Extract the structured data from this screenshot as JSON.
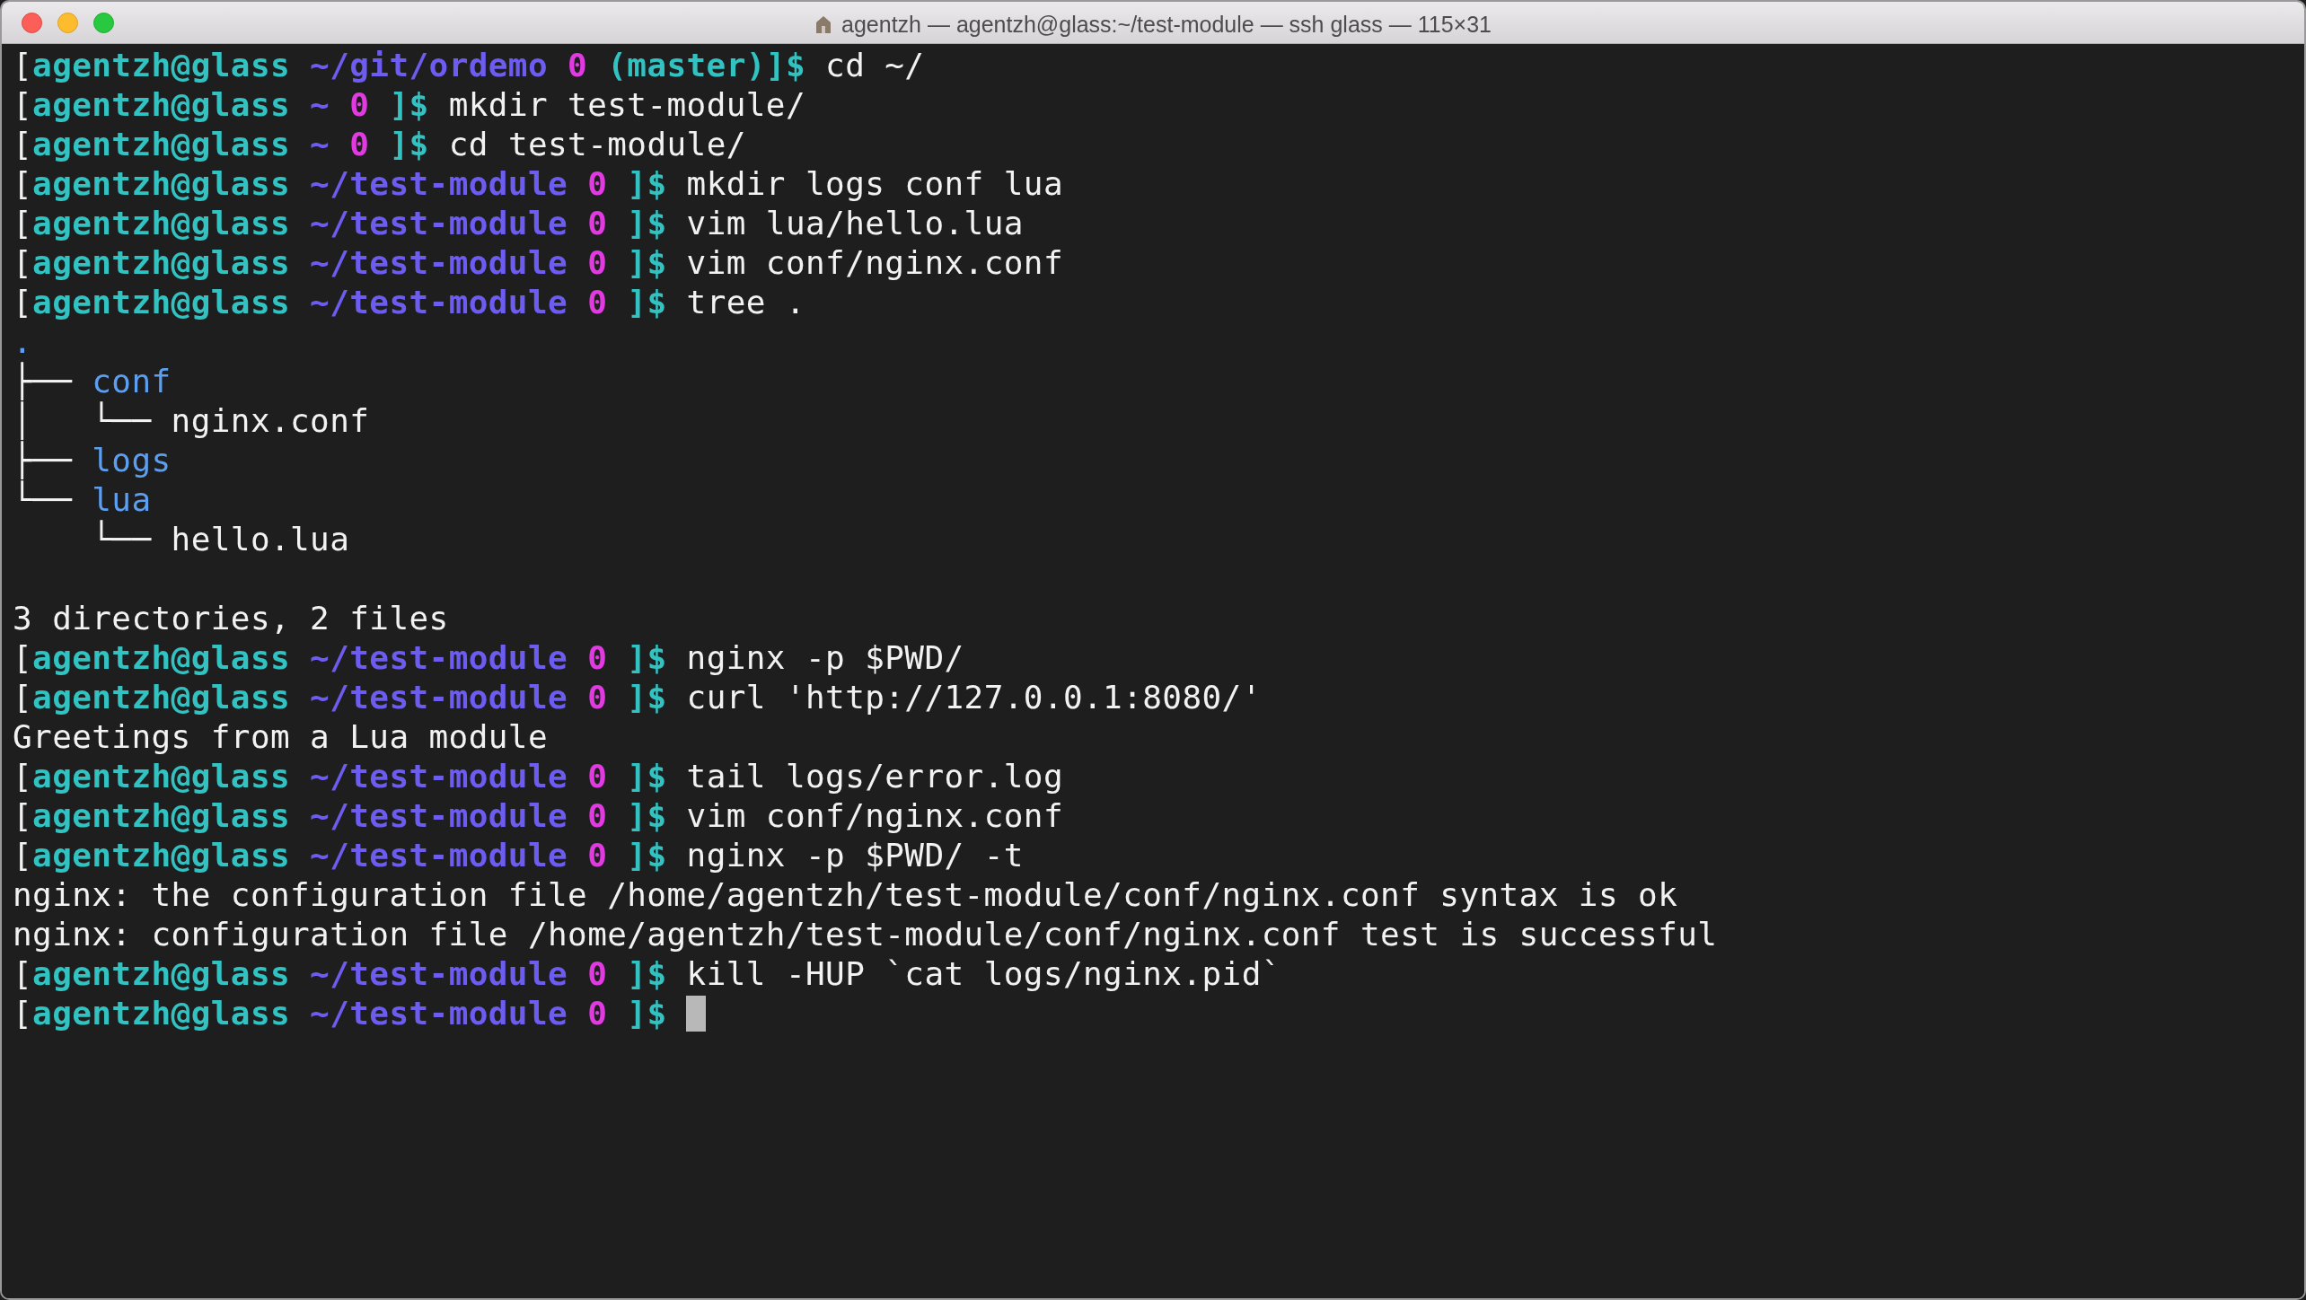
{
  "window": {
    "title": "agentzh — agentzh@glass:~/test-module — ssh glass — 115×31"
  },
  "lines": [
    {
      "kind": "prompt",
      "segments": [
        {
          "text": "[",
          "kind": "plain"
        },
        {
          "text": "agentzh@glass",
          "kind": "user"
        },
        {
          "text": " ~/git/ordemo",
          "kind": "path"
        },
        {
          "text": " 0",
          "kind": "status"
        },
        {
          "text": " (master)",
          "kind": "branch"
        },
        {
          "text": "]$",
          "kind": "user"
        },
        {
          "text": " cd ~/",
          "kind": "plain"
        }
      ]
    },
    {
      "kind": "prompt",
      "segments": [
        {
          "text": "[",
          "kind": "plain"
        },
        {
          "text": "agentzh@glass",
          "kind": "user"
        },
        {
          "text": " ~",
          "kind": "path"
        },
        {
          "text": " 0",
          "kind": "status"
        },
        {
          "text": " ]$",
          "kind": "user"
        },
        {
          "text": " mkdir test-module/",
          "kind": "plain"
        }
      ]
    },
    {
      "kind": "prompt",
      "segments": [
        {
          "text": "[",
          "kind": "plain"
        },
        {
          "text": "agentzh@glass",
          "kind": "user"
        },
        {
          "text": " ~",
          "kind": "path"
        },
        {
          "text": " 0",
          "kind": "status"
        },
        {
          "text": " ]$",
          "kind": "user"
        },
        {
          "text": " cd test-module/",
          "kind": "plain"
        }
      ]
    },
    {
      "kind": "prompt",
      "segments": [
        {
          "text": "[",
          "kind": "plain"
        },
        {
          "text": "agentzh@glass",
          "kind": "user"
        },
        {
          "text": " ~/test-module",
          "kind": "path"
        },
        {
          "text": " 0",
          "kind": "status"
        },
        {
          "text": " ]$",
          "kind": "user"
        },
        {
          "text": " mkdir logs conf lua",
          "kind": "plain"
        }
      ]
    },
    {
      "kind": "prompt",
      "segments": [
        {
          "text": "[",
          "kind": "plain"
        },
        {
          "text": "agentzh@glass",
          "kind": "user"
        },
        {
          "text": " ~/test-module",
          "kind": "path"
        },
        {
          "text": " 0",
          "kind": "status"
        },
        {
          "text": " ]$",
          "kind": "user"
        },
        {
          "text": " vim lua/hello.lua",
          "kind": "plain"
        }
      ]
    },
    {
      "kind": "prompt",
      "segments": [
        {
          "text": "[",
          "kind": "plain"
        },
        {
          "text": "agentzh@glass",
          "kind": "user"
        },
        {
          "text": " ~/test-module",
          "kind": "path"
        },
        {
          "text": " 0",
          "kind": "status"
        },
        {
          "text": " ]$",
          "kind": "user"
        },
        {
          "text": " vim conf/nginx.conf",
          "kind": "plain"
        }
      ]
    },
    {
      "kind": "prompt",
      "segments": [
        {
          "text": "[",
          "kind": "plain"
        },
        {
          "text": "agentzh@glass",
          "kind": "user"
        },
        {
          "text": " ~/test-module",
          "kind": "path"
        },
        {
          "text": " 0",
          "kind": "status"
        },
        {
          "text": " ]$",
          "kind": "user"
        },
        {
          "text": " tree .",
          "kind": "plain"
        }
      ]
    },
    {
      "kind": "output",
      "segments": [
        {
          "text": ".",
          "kind": "dir"
        }
      ]
    },
    {
      "kind": "output",
      "segments": [
        {
          "text": "├── ",
          "kind": "plain"
        },
        {
          "text": "conf",
          "kind": "dir"
        }
      ]
    },
    {
      "kind": "output",
      "segments": [
        {
          "text": "│   └── nginx.conf",
          "kind": "plain"
        }
      ]
    },
    {
      "kind": "output",
      "segments": [
        {
          "text": "├── ",
          "kind": "plain"
        },
        {
          "text": "logs",
          "kind": "dir"
        }
      ]
    },
    {
      "kind": "output",
      "segments": [
        {
          "text": "└── ",
          "kind": "plain"
        },
        {
          "text": "lua",
          "kind": "dir"
        }
      ]
    },
    {
      "kind": "output",
      "segments": [
        {
          "text": "    └── hello.lua",
          "kind": "plain"
        }
      ]
    },
    {
      "kind": "blank"
    },
    {
      "kind": "output",
      "segments": [
        {
          "text": "3 directories, 2 files",
          "kind": "plain"
        }
      ]
    },
    {
      "kind": "prompt",
      "segments": [
        {
          "text": "[",
          "kind": "plain"
        },
        {
          "text": "agentzh@glass",
          "kind": "user"
        },
        {
          "text": " ~/test-module",
          "kind": "path"
        },
        {
          "text": " 0",
          "kind": "status"
        },
        {
          "text": " ]$",
          "kind": "user"
        },
        {
          "text": " nginx -p $PWD/",
          "kind": "plain"
        }
      ]
    },
    {
      "kind": "prompt",
      "segments": [
        {
          "text": "[",
          "kind": "plain"
        },
        {
          "text": "agentzh@glass",
          "kind": "user"
        },
        {
          "text": " ~/test-module",
          "kind": "path"
        },
        {
          "text": " 0",
          "kind": "status"
        },
        {
          "text": " ]$",
          "kind": "user"
        },
        {
          "text": " curl 'http://127.0.0.1:8080/'",
          "kind": "plain"
        }
      ]
    },
    {
      "kind": "output",
      "segments": [
        {
          "text": "Greetings from a Lua module",
          "kind": "plain"
        }
      ]
    },
    {
      "kind": "prompt",
      "segments": [
        {
          "text": "[",
          "kind": "plain"
        },
        {
          "text": "agentzh@glass",
          "kind": "user"
        },
        {
          "text": " ~/test-module",
          "kind": "path"
        },
        {
          "text": " 0",
          "kind": "status"
        },
        {
          "text": " ]$",
          "kind": "user"
        },
        {
          "text": " tail logs/error.log",
          "kind": "plain"
        }
      ]
    },
    {
      "kind": "prompt",
      "segments": [
        {
          "text": "[",
          "kind": "plain"
        },
        {
          "text": "agentzh@glass",
          "kind": "user"
        },
        {
          "text": " ~/test-module",
          "kind": "path"
        },
        {
          "text": " 0",
          "kind": "status"
        },
        {
          "text": " ]$",
          "kind": "user"
        },
        {
          "text": " vim conf/nginx.conf",
          "kind": "plain"
        }
      ]
    },
    {
      "kind": "prompt",
      "segments": [
        {
          "text": "[",
          "kind": "plain"
        },
        {
          "text": "agentzh@glass",
          "kind": "user"
        },
        {
          "text": " ~/test-module",
          "kind": "path"
        },
        {
          "text": " 0",
          "kind": "status"
        },
        {
          "text": " ]$",
          "kind": "user"
        },
        {
          "text": " nginx -p $PWD/ -t",
          "kind": "plain"
        }
      ]
    },
    {
      "kind": "output",
      "segments": [
        {
          "text": "nginx: the configuration file /home/agentzh/test-module/conf/nginx.conf syntax is ok",
          "kind": "plain"
        }
      ]
    },
    {
      "kind": "output",
      "segments": [
        {
          "text": "nginx: configuration file /home/agentzh/test-module/conf/nginx.conf test is successful",
          "kind": "plain"
        }
      ]
    },
    {
      "kind": "prompt",
      "segments": [
        {
          "text": "[",
          "kind": "plain"
        },
        {
          "text": "agentzh@glass",
          "kind": "user"
        },
        {
          "text": " ~/test-module",
          "kind": "path"
        },
        {
          "text": " 0",
          "kind": "status"
        },
        {
          "text": " ]$",
          "kind": "user"
        },
        {
          "text": " kill -HUP `cat logs/nginx.pid`",
          "kind": "plain"
        }
      ]
    },
    {
      "kind": "cursor",
      "segments": [
        {
          "text": "[",
          "kind": "plain"
        },
        {
          "text": "agentzh@glass",
          "kind": "user"
        },
        {
          "text": " ~/test-module",
          "kind": "path"
        },
        {
          "text": " 0",
          "kind": "status"
        },
        {
          "text": " ]$",
          "kind": "user"
        }
      ]
    }
  ]
}
